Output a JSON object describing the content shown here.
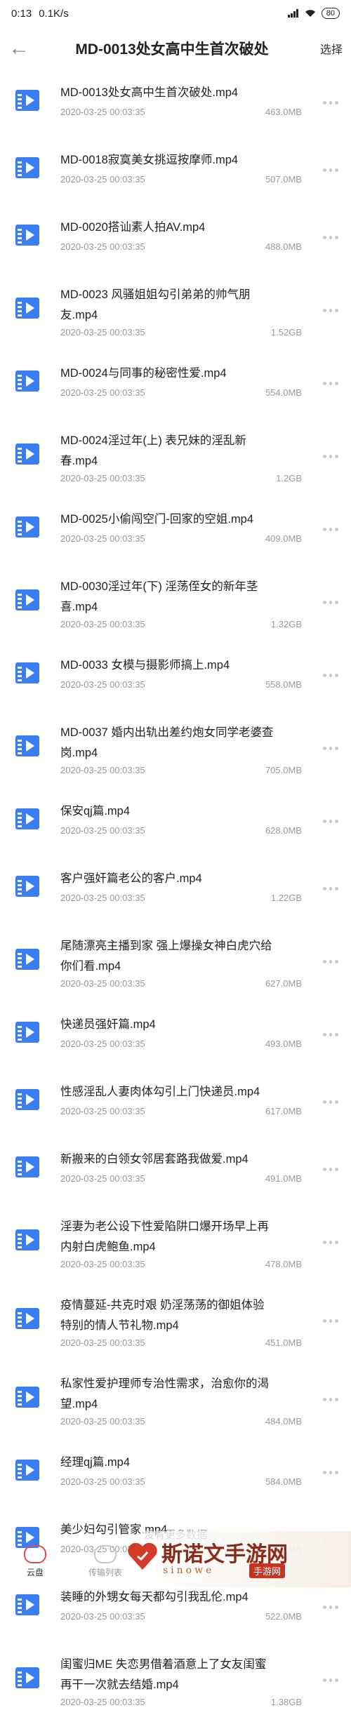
{
  "status_bar": {
    "time": "0:13",
    "speed": "0.1K/s",
    "battery": "80"
  },
  "header": {
    "title": "MD-0013处女高中生首次破处",
    "select_label": "选择"
  },
  "files": [
    {
      "lines": [
        "MD-0013处女高中生首次破处.mp4"
      ],
      "date": "2020-03-25 00:03:35",
      "size": "463.0MB"
    },
    {
      "lines": [
        "MD-0018寂寞美女挑逗按摩师.mp4"
      ],
      "date": "2020-03-25 00:03:35",
      "size": "507.0MB"
    },
    {
      "lines": [
        "MD-0020搭讪素人拍AV.mp4"
      ],
      "date": "2020-03-25 00:03:35",
      "size": "488.0MB"
    },
    {
      "lines": [
        "MD-0023 风骚姐姐勾引弟弟的帅气朋",
        "友.mp4"
      ],
      "date": "2020-03-25 00:03:35",
      "size": "1.52GB"
    },
    {
      "lines": [
        "MD-0024与同事的秘密性爱.mp4"
      ],
      "date": "2020-03-25 00:03:35",
      "size": "554.0MB"
    },
    {
      "lines": [
        "MD-0024淫过年(上) 表兄妹的淫乱新",
        "春.mp4"
      ],
      "date": "2020-03-25 00:03:35",
      "size": "1.2GB"
    },
    {
      "lines": [
        "MD-0025小偷闯空门-回家的空姐.mp4"
      ],
      "date": "2020-03-25 00:03:35",
      "size": "409.0MB"
    },
    {
      "lines": [
        "MD-0030淫过年(下) 淫荡侄女的新年茎",
        "喜.mp4"
      ],
      "date": "2020-03-25 00:03:35",
      "size": "1.32GB"
    },
    {
      "lines": [
        "MD-0033 女模与摄影师搞上.mp4"
      ],
      "date": "2020-03-25 00:03:35",
      "size": "558.0MB"
    },
    {
      "lines": [
        "MD-0037 婚内出轨出差约炮女同学老婆查",
        "岗.mp4"
      ],
      "date": "2020-03-25 00:03:35",
      "size": "705.0MB"
    },
    {
      "lines": [
        "保安qj篇.mp4"
      ],
      "date": "2020-03-25 00:03:35",
      "size": "628.0MB"
    },
    {
      "lines": [
        "客户强奸篇老公的客户.mp4"
      ],
      "date": "2020-03-25 00:03:35",
      "size": "1.22GB"
    },
    {
      "lines": [
        "尾随漂亮主播到家 强上爆操女神白虎穴给",
        "你们看.mp4"
      ],
      "date": "2020-03-25 00:03:35",
      "size": "627.0MB"
    },
    {
      "lines": [
        "快递员强奸篇.mp4"
      ],
      "date": "2020-03-25 00:03:35",
      "size": "493.0MB"
    },
    {
      "lines": [
        "性感淫乱人妻肉体勾引上门快递员.mp4"
      ],
      "date": "2020-03-25 00:03:35",
      "size": "617.0MB"
    },
    {
      "lines": [
        "新搬来的白领女邻居套路我做爱.mp4"
      ],
      "date": "2020-03-25 00:03:35",
      "size": "491.0MB"
    },
    {
      "lines": [
        "淫妻为老公设下性爱陷阱口爆开场早上再",
        "内射白虎鲍鱼.mp4"
      ],
      "date": "2020-03-25 00:03:35",
      "size": "478.0MB"
    },
    {
      "lines": [
        "疫情蔓延-共克时艰 奶淫荡荡的御姐体验",
        "特别的情人节礼物.mp4"
      ],
      "date": "2020-03-25 00:03:35",
      "size": "451.0MB"
    },
    {
      "lines": [
        "私家性爱护理师专治性需求，治愈你的渴",
        "望.mp4"
      ],
      "date": "2020-03-25 00:03:35",
      "size": "484.0MB"
    },
    {
      "lines": [
        "经理qj篇.mp4"
      ],
      "date": "2020-03-25 00:03:35",
      "size": "584.0MB"
    },
    {
      "lines": [
        "美少妇勾引管家.mp4"
      ],
      "date": "2020-03-25 00:03:35",
      "size": "496.0MB"
    },
    {
      "lines": [
        "装睡的外甥女每天都勾引我乱伦.mp4"
      ],
      "date": "2020-03-25 00:03:35",
      "size": "522.0MB"
    },
    {
      "lines": [
        "闺蜜归ME 失恋男借着酒意上了女友闺蜜",
        "再干一次就去结婚.mp4"
      ],
      "date": "2020-03-25 00:03:35",
      "size": "1.38GB"
    }
  ],
  "footer_note": "没有更多数据",
  "tabs": [
    {
      "label": "云盘"
    },
    {
      "label": "传输列表"
    }
  ],
  "watermark": {
    "title": "斯诺文手游网",
    "subtitle": "sinowe",
    "badge": "手游网"
  },
  "colors": {
    "accent": "#3a7ef4",
    "watermark": "#8a2a1a"
  }
}
